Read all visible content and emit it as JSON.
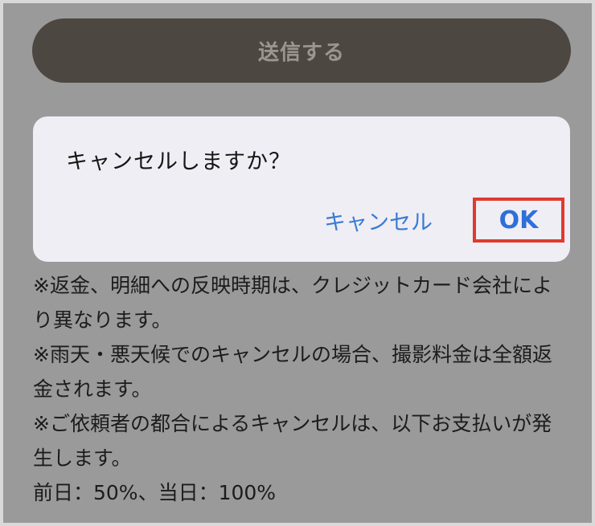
{
  "form": {
    "submit_label": "送信する"
  },
  "notes": {
    "lines": [
      "※返金、明細への反映時期は、クレジットカード会社により異なります。",
      "※雨天・悪天候でのキャンセルの場合、撮影料金は全額返金されます。",
      "※ご依頼者の都合によるキャンセルは、以下お支払いが発生します。",
      "前日：50%、当日：100%"
    ]
  },
  "dialog": {
    "message": "キャンセルしますか？",
    "cancel_label": "キャンセル",
    "ok_label": "OK"
  },
  "colors": {
    "overlay": "#9a9a9a",
    "dialog_background": "#efeef4",
    "button_blue": "#3a7bd5",
    "highlight_red": "#e03a2f",
    "submit_button": "#4d4741"
  }
}
